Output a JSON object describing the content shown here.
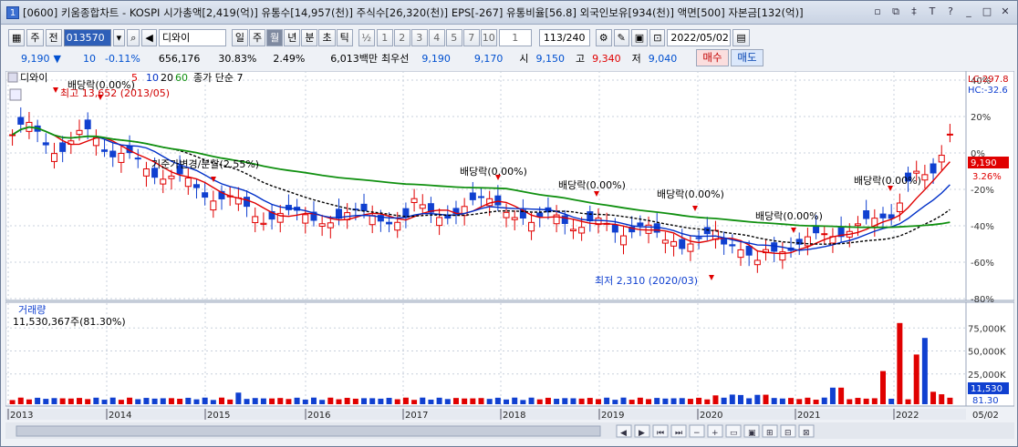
{
  "title": "[0600] 키움종합차트 - KOSPI 시가총액[2,419(억)] 유통수[14,957(천)] 주식수[26,320(천)] EPS[-267] 유통비율[56.8] 외국인보유[934(천)] 액면[500] 자본금[132(억)]",
  "window_number": "1",
  "toolbar": {
    "period_day": "주",
    "prev": "전",
    "code": "013570",
    "stock_name": "디와이",
    "timeframes": [
      "일",
      "주",
      "월",
      "년",
      "분",
      "초",
      "틱"
    ],
    "selected_timeframe": "월",
    "half": "½",
    "nums": [
      "1",
      "2",
      "3",
      "4",
      "5",
      "7",
      "10"
    ],
    "spinner_value": "1",
    "count": "113/240",
    "date": "2022/05/02"
  },
  "info": {
    "price": "9,190",
    "arrow": "▼",
    "change": "10",
    "change_pct": "-0.11%",
    "volume": "656,176",
    "turnover": "30.83%",
    "vol_ratio": "2.49%",
    "amount": "6,013백만",
    "best_label": "최우선",
    "best_ask": "9,190",
    "best_bid": "9,170",
    "open_label": "시",
    "open": "9,150",
    "high_label": "고",
    "high": "9,340",
    "low_label": "저",
    "low": "9,040"
  },
  "buttons": {
    "buy": "매수",
    "sell": "매도"
  },
  "legend": {
    "name": "디와이",
    "ma": [
      "5",
      "10",
      "20",
      "60"
    ],
    "ma_colors": [
      "#e00000",
      "#0030c8",
      "#000000",
      "#109010"
    ],
    "tail": "종가 단순 7"
  },
  "annotations": {
    "high_label": "최고 13,652 (2013/05)",
    "low_label": "최저 2,310 (2020/03)",
    "div_labels": [
      "배당락(0.00%)",
      "배당락(0.00%)",
      "배당락(0.00%)",
      "배당락(0.00%)",
      "배당락(0.00%)",
      "배당락(0.00%)"
    ],
    "split_label": "기준가변경/분할(2.55%)"
  },
  "right_axis": {
    "lc": "LC:297.8",
    "hc": "HC:-32.6",
    "price_ticks": [
      "40%",
      "20%",
      "0%",
      "-20%",
      "-40%",
      "-60%",
      "-80%"
    ],
    "current_price": "9,190",
    "current_pct": "3.26%",
    "vol_ticks": [
      "75,000K",
      "50,000K",
      "25,000K"
    ],
    "current_vol": "11,530",
    "current_vol_pct": "81.30"
  },
  "volume_panel": {
    "title": "거래량",
    "value": "11,530,367주(81.30%)"
  },
  "x_axis": {
    "years": [
      "2013",
      "2014",
      "2015",
      "2016",
      "2017",
      "2018",
      "2019",
      "2020",
      "2021",
      "2022"
    ],
    "end_label": "05/02"
  },
  "chart_data": {
    "type": "candlestick",
    "title": "디와이",
    "timeframe": "monthly",
    "moving_averages": [
      "5",
      "10",
      "20",
      "60"
    ],
    "price_range_pct": [
      -80,
      40
    ],
    "events": [
      {
        "label": "최고 13,652",
        "date": "2013/05"
      },
      {
        "label": "최저 2,310",
        "date": "2020/03"
      },
      {
        "label": "기준가변경/분할",
        "value_pct": 2.55
      }
    ],
    "last": {
      "close": 9190,
      "open": 9150,
      "high": 9340,
      "low": 9040,
      "change": -10,
      "change_pct": -0.11
    },
    "volume": {
      "last": 11530367,
      "pct": 81.3
    }
  }
}
